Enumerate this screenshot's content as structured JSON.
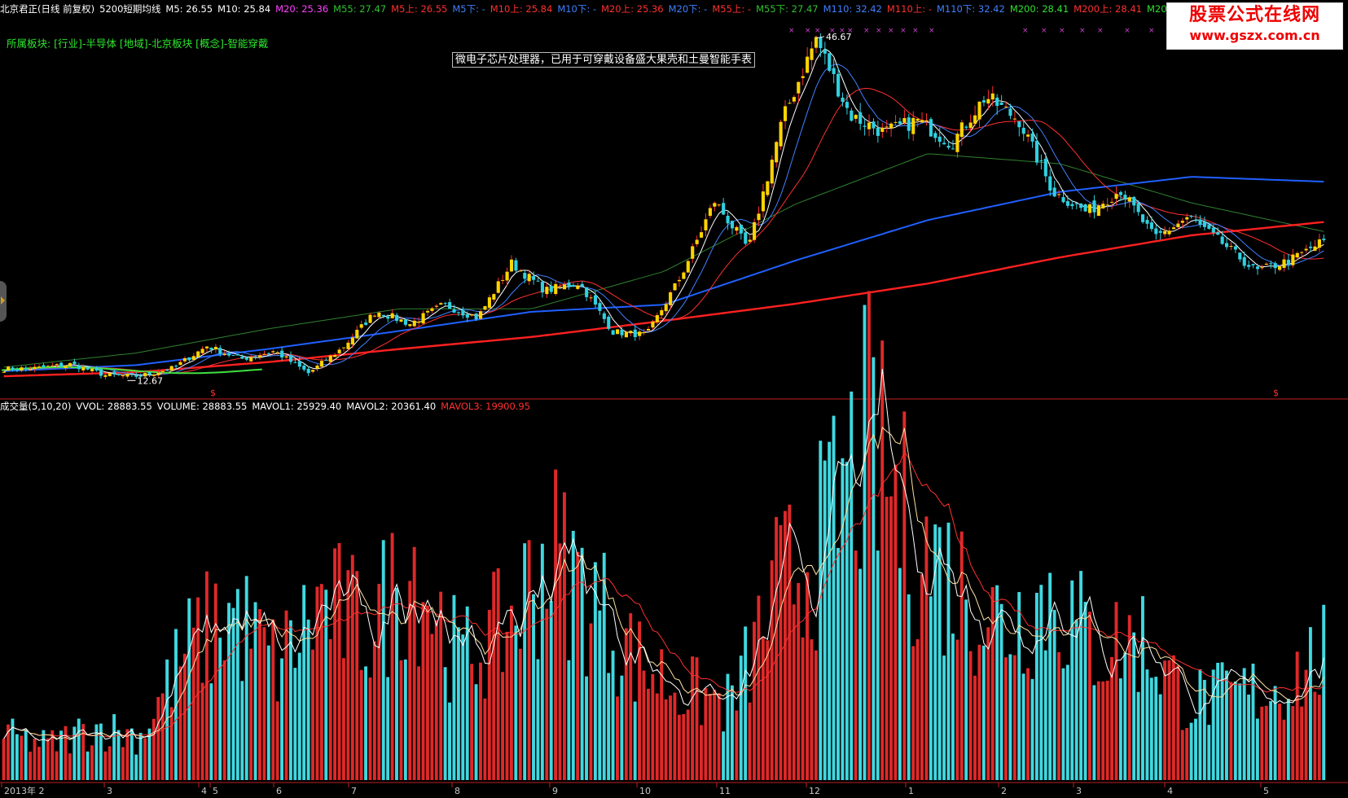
{
  "header": {
    "stock_name": "北京君正(日线 前复权)",
    "indicator_name": "5200短期均线",
    "ma_values": [
      {
        "label": "M5: 26.55",
        "color": "#ffffff"
      },
      {
        "label": "M10: 25.84",
        "color": "#ffffff"
      },
      {
        "label": "M20: 25.36",
        "color": "#ff40ff"
      },
      {
        "label": "M55: 27.47",
        "color": "#30c030"
      },
      {
        "label": "M5上: 26.55",
        "color": "#ff3030"
      },
      {
        "label": "M5下: -",
        "color": "#4080ff"
      },
      {
        "label": "M10上: 25.84",
        "color": "#ff3030"
      },
      {
        "label": "M10下: -",
        "color": "#4080ff"
      },
      {
        "label": "M20上: 25.36",
        "color": "#ff3030"
      },
      {
        "label": "M20下: -",
        "color": "#4080ff"
      },
      {
        "label": "M55上: -",
        "color": "#ff3030"
      },
      {
        "label": "M55下: 27.47",
        "color": "#30c030"
      },
      {
        "label": "M110: 32.42",
        "color": "#4080ff"
      },
      {
        "label": "M110上: -",
        "color": "#ff3030"
      },
      {
        "label": "M110下: 32.42",
        "color": "#4080ff"
      },
      {
        "label": "M200: 28.41",
        "color": "#30e030"
      },
      {
        "label": "M200上: 28.41",
        "color": "#ff3030"
      },
      {
        "label": "M200下: -",
        "color": "#30e030"
      }
    ],
    "sector_line": "所属板块: [行业]-半导体  [地域]-北京板块  [概念]-智能穿戴",
    "description": "微电子芯片处理器，已用于可穿戴设备盛大果壳和土曼智能手表"
  },
  "logo": {
    "line1": "股票公式在线网",
    "line2": "www.gszx.com.cn"
  },
  "volume_header": {
    "name": "成交量(5,10,20)",
    "items": [
      {
        "label": "VVOL: 28883.55",
        "color": "#ffffff"
      },
      {
        "label": "VOLUME: 28883.55",
        "color": "#ffffff"
      },
      {
        "label": "MAVOL1: 25929.40",
        "color": "#ffffff"
      },
      {
        "label": "MAVOL2: 20361.40",
        "color": "#ffffff"
      },
      {
        "label": "MAVOL3: 19900.95",
        "color": "#ff3030"
      }
    ]
  },
  "chart_data": [
    {
      "type": "candlestick",
      "annotations": {
        "high_label": "46.67",
        "low_label": "12.67",
        "marker": "$"
      },
      "colors": {
        "up": "#ffd400",
        "down": "#30d0e0",
        "ma5": "#ffffff",
        "ma10": "#4080ff",
        "ma20": "#ff3030",
        "ma55": "#308030",
        "ma110": "#2060ff",
        "ma200": "#ff2020",
        "green_ma": "#40e040"
      },
      "y_range": [
        11,
        49
      ],
      "key_prices": [
        13.8,
        13.9,
        14.3,
        13.2,
        13.1,
        13.9,
        16.1,
        14.8,
        15.6,
        13.4,
        15.9,
        19.6,
        18.3,
        20.2,
        18.9,
        24.3,
        21.6,
        22.4,
        17.5,
        17.2,
        23.0,
        30.5,
        25.7,
        38.5,
        46.67,
        39.0,
        37.3,
        38.5,
        36.2,
        40.9,
        38.5,
        31.4,
        29.4,
        31.6,
        26.8,
        28.9,
        26.3,
        23.5,
        24.6,
        26.55
      ],
      "ma200_key": [
        13.1,
        13.5,
        14.5,
        15.8,
        17.0,
        18.6,
        20.3,
        22.3,
        24.9,
        27.1,
        28.41
      ],
      "ma110_key": [
        13.6,
        14.2,
        15.8,
        17.6,
        19.5,
        20.2,
        24.6,
        28.6,
        31.4,
        32.9,
        32.42
      ],
      "ma55_key": [
        14.0,
        15.4,
        17.8,
        19.8,
        19.8,
        23.5,
        30.2,
        35.2,
        34.2,
        30.3,
        27.47
      ]
    },
    {
      "type": "bar",
      "title": "成交量(5,10,20)",
      "x_ticks": [
        "2013年 2",
        "3",
        "4",
        "5",
        "6",
        "7",
        "8",
        "9",
        "10",
        "11",
        "12",
        "1",
        "2",
        "3",
        "4",
        "5"
      ],
      "volume_key": [
        1.0,
        0.8,
        1.2,
        1.0,
        2.9,
        3.8,
        2.6,
        4.0,
        3.4,
        4.9,
        2.7,
        3.4,
        5.2,
        4.0,
        2.6,
        2.0,
        1.7,
        4.3,
        5.4,
        7.7,
        5.3,
        4.4,
        3.5,
        4.2,
        3.0,
        3.2,
        1.8,
        1.9,
        2.1,
        2.8
      ],
      "colors": {
        "up": "#e02828",
        "down": "#40d8e0",
        "mavol1": "#ffffff",
        "mavol2": "#ffe0a0",
        "mavol3": "#ff3030"
      }
    }
  ]
}
